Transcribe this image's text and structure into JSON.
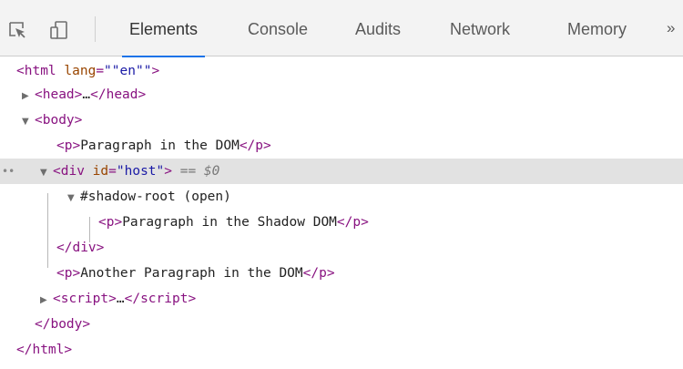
{
  "toolbar": {
    "icons": [
      "inspect-element-icon",
      "device-toolbar-icon"
    ],
    "tabs": [
      {
        "label": "Elements",
        "active": true
      },
      {
        "label": "Console",
        "active": false
      },
      {
        "label": "Audits",
        "active": false
      },
      {
        "label": "Network",
        "active": false
      },
      {
        "label": "Memory",
        "active": false
      }
    ],
    "more": "»"
  },
  "dom": {
    "html_open": {
      "tag": "html",
      "attr": "lang",
      "value": "\"en\"",
      "eq": "=",
      "q": "\""
    },
    "head": {
      "tag": "head",
      "ellipsis": "…"
    },
    "body_open": {
      "tag": "body"
    },
    "p1": {
      "tag": "p",
      "text": "Paragraph in the DOM"
    },
    "host": {
      "tag": "div",
      "attr": "id",
      "value": "\"host\"",
      "eq": "=",
      "selected_marker": "== $0",
      "dots": "••"
    },
    "shadow_root": {
      "label": "#shadow-root (open)"
    },
    "p_shadow": {
      "tag": "p",
      "text": "Paragraph in the Shadow DOM"
    },
    "div_close": {
      "tag": "div"
    },
    "p2": {
      "tag": "p",
      "text": "Another Paragraph in the DOM"
    },
    "script": {
      "tag": "script",
      "ellipsis": "…"
    },
    "body_close": {
      "tag": "body"
    },
    "html_close": {
      "tag": "html"
    }
  },
  "colors": {
    "tag": "#881280",
    "attr_name": "#994500",
    "attr_value": "#1a1aa6",
    "selected_row": "#e2e2e2",
    "active_tab_underline": "#1a73e8"
  }
}
